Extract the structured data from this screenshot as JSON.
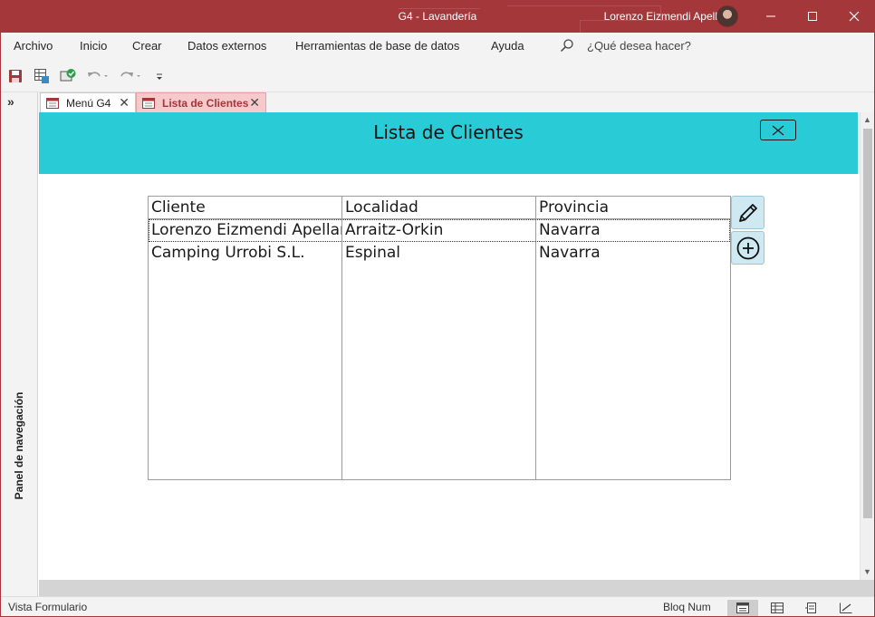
{
  "window": {
    "title": "G4 - Lavandería",
    "user_name": "Lorenzo Eizmendi Apellaniz",
    "accent_color": "#a4373a"
  },
  "menu": {
    "items": [
      "Archivo",
      "Inicio",
      "Crear",
      "Datos externos",
      "Herramientas de base de datos",
      "Ayuda"
    ],
    "tell_me": "¿Qué desea hacer?"
  },
  "quick_access": {
    "icons": [
      "save-icon",
      "datasheet-view-icon",
      "sync-check-icon",
      "undo-icon",
      "redo-icon",
      "customize-icon"
    ]
  },
  "nav_pane": {
    "label": "Panel de navegación",
    "toggle_icon": "double-chevron-right-icon"
  },
  "tabs": [
    {
      "label": "Menú G4",
      "active": false
    },
    {
      "label": "Lista de Clientes",
      "active": true
    }
  ],
  "form": {
    "title": "Lista de Clientes",
    "header_color": "#29ccd6",
    "close_icon": "close-icon"
  },
  "datasheet": {
    "columns": [
      "Cliente",
      "Localidad",
      "Provincia"
    ],
    "rows": [
      [
        "Lorenzo Eizmendi Apellaniz",
        "Arraitz-Orkin",
        "Navarra"
      ],
      [
        "Camping Urrobi S.L.",
        "Espinal",
        "Navarra"
      ]
    ]
  },
  "side_buttons": {
    "edit_icon": "pencil-icon",
    "add_icon": "plus-circle-icon"
  },
  "status_bar": {
    "text": "Vista Formulario",
    "num_lock": "Bloq Num"
  }
}
